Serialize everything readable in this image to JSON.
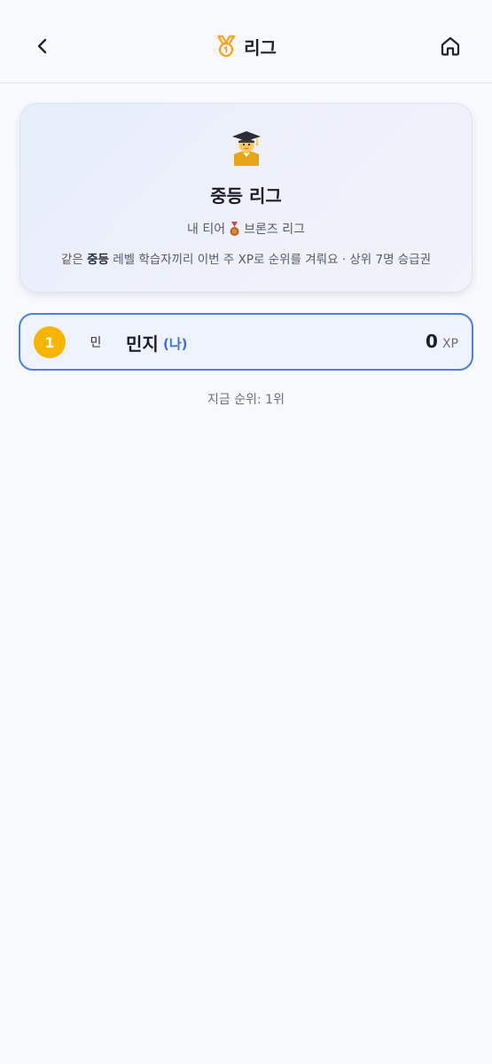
{
  "header": {
    "title": "리그",
    "back_icon": "chevron-left-icon",
    "title_icon": "medal-icon",
    "home_icon": "home-icon",
    "accent_color": "#f5a623"
  },
  "league": {
    "icon": "graduate-icon",
    "name": "중등 리그",
    "tier_prefix": "내 티어",
    "tier_icon": "bronze-medal-icon",
    "tier_name": "브론즈 리그",
    "desc_prefix": "같은",
    "desc_level": "중등",
    "desc_suffix": "레벨 학습자끼리 이번 주 XP로 순위를 겨뤄요 · 상위 7명 승급권"
  },
  "leaderboard": [
    {
      "rank": "1",
      "avatar_text": "민",
      "name": "민지",
      "me_tag": "(나)",
      "xp": "0",
      "xp_unit": "XP"
    }
  ],
  "status": {
    "current_rank": "지금 순위: 1위"
  },
  "colors": {
    "background": "#f8f9fd",
    "highlight_border": "#4d7ee0",
    "rank_gold": "#f7b500",
    "me_tag": "#3b6fd8"
  }
}
